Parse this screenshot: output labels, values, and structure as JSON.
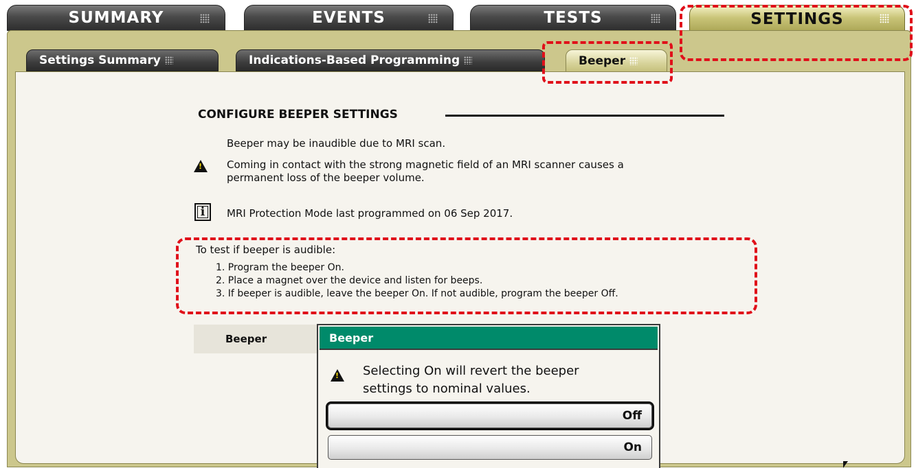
{
  "top_tabs": [
    {
      "label": "SUMMARY"
    },
    {
      "label": "EVENTS"
    },
    {
      "label": "TESTS"
    },
    {
      "label": "SETTINGS"
    }
  ],
  "sub_tabs": [
    {
      "label": "Settings Summary"
    },
    {
      "label": "Indications-Based Programming"
    },
    {
      "label": "Beeper"
    }
  ],
  "content": {
    "title": "CONFIGURE BEEPER SETTINGS",
    "warning_line1": "Beeper may be inaudible due to MRI scan.",
    "warning_line2": "Coming in contact with the strong magnetic field of an MRI scanner causes a",
    "warning_line3": "permanent loss of the beeper volume.",
    "info_text": "MRI Protection Mode last programmed on 06 Sep 2017.",
    "test_heading": "To test if beeper is audible:",
    "test_steps": [
      "1. Program the beeper On.",
      "2. Place a magnet over the device and listen for beeps.",
      "3. If beeper is audible, leave the beeper On. If not audible, program the beeper Off."
    ],
    "field_label": "Beeper"
  },
  "dialog": {
    "title": "Beeper",
    "message_line1": "Selecting On will revert the beeper",
    "message_line2": "settings to nominal values.",
    "options": [
      "Off",
      "On"
    ],
    "focused_option": "Off"
  },
  "annotation_color": "#e0101a",
  "accent_color": "#008a6a",
  "icons": [
    "grip-icon",
    "warning-icon",
    "info-icon",
    "mouse-cursor-icon"
  ]
}
